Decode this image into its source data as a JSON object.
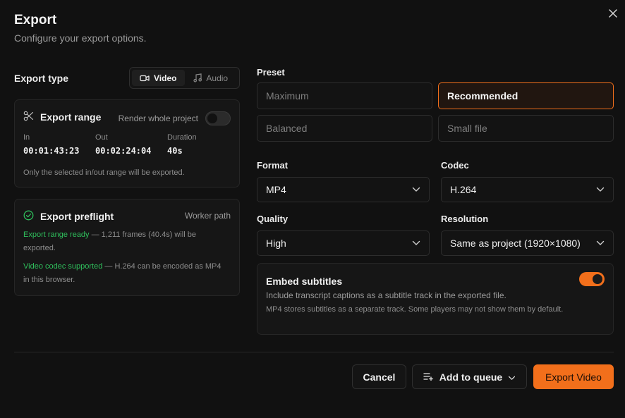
{
  "dialog": {
    "title": "Export",
    "subtitle": "Configure your export options."
  },
  "export_type": {
    "label": "Export type",
    "options": [
      "Video",
      "Audio"
    ],
    "selected": "Video"
  },
  "export_range": {
    "title": "Export range",
    "render_whole_label": "Render whole project",
    "render_whole_enabled": false,
    "in_label": "In",
    "in_value": "00:01:43:23",
    "out_label": "Out",
    "out_value": "00:02:24:04",
    "duration_label": "Duration",
    "duration_value": "40s",
    "note": "Only the selected in/out range will be exported."
  },
  "preflight": {
    "title": "Export preflight",
    "path_label": "Worker path",
    "check1_status": "Export range ready",
    "check1_detail": " — 1,211 frames (40.4s) will be exported.",
    "check2_status": "Video codec supported",
    "check2_detail": " — H.264 can be encoded as MP4 in this browser."
  },
  "preset": {
    "label": "Preset",
    "options": [
      "Maximum",
      "Recommended",
      "Balanced",
      "Small file"
    ],
    "selected": "Recommended"
  },
  "format": {
    "label": "Format",
    "value": "MP4"
  },
  "codec": {
    "label": "Codec",
    "value": "H.264"
  },
  "quality": {
    "label": "Quality",
    "value": "High"
  },
  "resolution": {
    "label": "Resolution",
    "value": "Same as project (1920×1080)"
  },
  "subtitles": {
    "title": "Embed subtitles",
    "description": "Include transcript captions as a subtitle track in the exported file.",
    "note": "MP4 stores subtitles as a separate track. Some players may not show them by default.",
    "enabled": true
  },
  "footer": {
    "cancel_label": "Cancel",
    "queue_label": "Add to queue",
    "export_label": "Export Video"
  },
  "colors": {
    "accent": "#f26f1b",
    "success": "#2fbf5c",
    "background": "#111111"
  }
}
